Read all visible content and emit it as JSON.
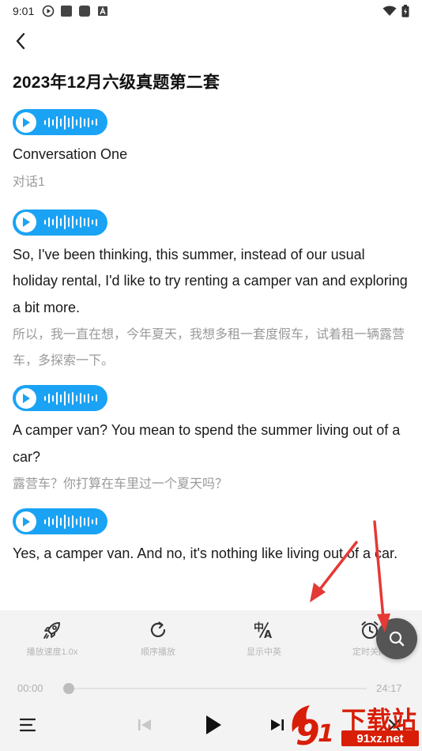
{
  "status": {
    "time": "9:01",
    "icons": [
      "play-status-icon",
      "square-status-icon",
      "square-status-icon",
      "a-status-icon"
    ],
    "right_icons": [
      "wifi-icon",
      "battery-icon"
    ]
  },
  "header": {
    "title": "2023年12月六级真题第二套"
  },
  "transcript": [
    {
      "en": "Conversation One",
      "zh": "对话1"
    },
    {
      "en": "So, I've been thinking, this summer, instead of our usual holiday rental, I'd like to try renting a camper van and exploring a bit more.",
      "zh": "所以，我一直在想，今年夏天，我想多租一套度假车，试着租一辆露营车，多探索一下。"
    },
    {
      "en": "A camper van? You mean to spend the summer living out of a car?",
      "zh": "露营车？你打算在车里过一个夏天吗？"
    },
    {
      "en": "Yes, a camper van. And no, it's nothing like living out of a car.",
      "zh": ""
    }
  ],
  "controls": {
    "speed_label": "播放速度1.0x",
    "order_label": "顺序播放",
    "display_label": "显示中英",
    "timer_label": "定时关闭"
  },
  "progress": {
    "current": "00:00",
    "total": "24:17",
    "fraction": 0.0
  },
  "colors": {
    "accent": "#1aa3f5",
    "panel": "#f3f3f3",
    "arrow": "#e53935",
    "watermark": "#d81e06"
  },
  "watermark": {
    "text": "下载站",
    "url": "91xz.net"
  }
}
